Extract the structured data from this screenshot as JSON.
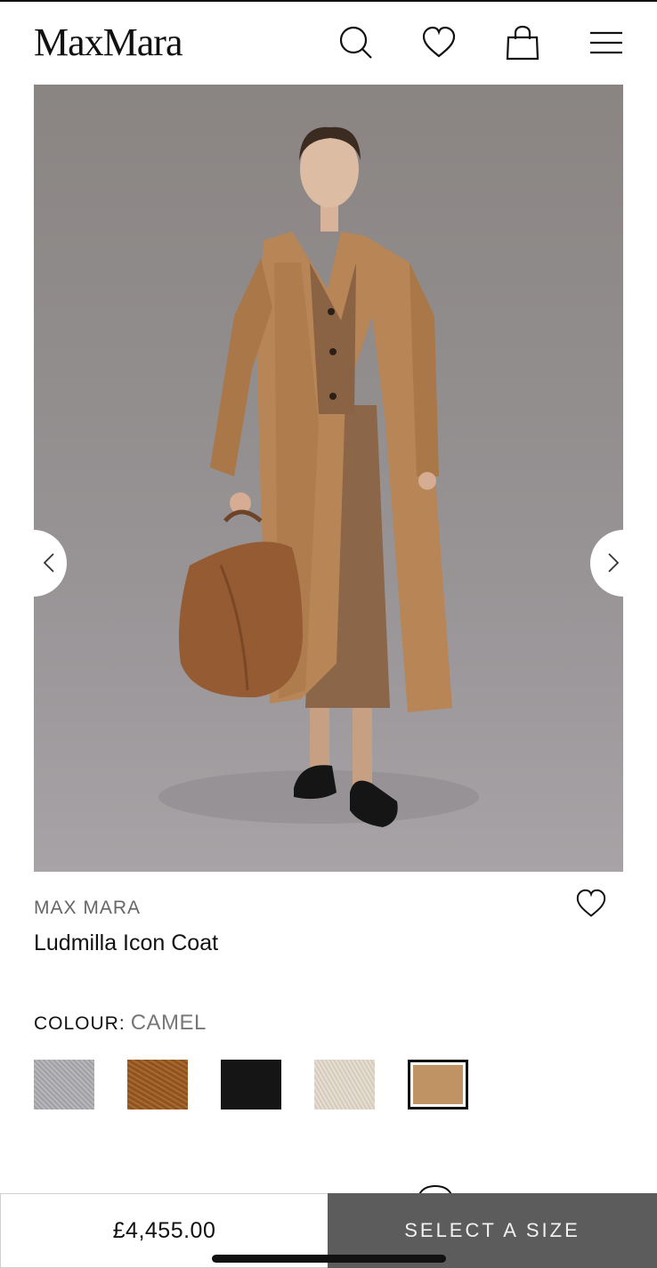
{
  "header": {
    "logo_text": "MaxMara",
    "icons": [
      "search-icon",
      "heart-icon",
      "bag-icon",
      "menu-icon"
    ]
  },
  "gallery": {
    "image_description_icon": "product-photo",
    "prev_icon": "chevron-left-icon",
    "next_icon": "chevron-right-icon"
  },
  "product": {
    "brand": "MAX MARA",
    "name": "Ludmilla Icon Coat",
    "colour_label": "COLOUR:",
    "colour_value": "CAMEL",
    "swatches": [
      {
        "name": "grey",
        "color": "#a9a8ad"
      },
      {
        "name": "brown",
        "color": "#9a5a22"
      },
      {
        "name": "black",
        "color": "#151515"
      },
      {
        "name": "ivory",
        "color": "#ddd3c3"
      },
      {
        "name": "camel",
        "color": "#c09365",
        "selected": true
      }
    ]
  },
  "purchase": {
    "price": "£4,455.00",
    "cta_label": "SELECT A SIZE"
  },
  "colors": {
    "cta_background": "#5c5c5c",
    "text_primary": "#111111",
    "text_secondary": "#666666"
  }
}
